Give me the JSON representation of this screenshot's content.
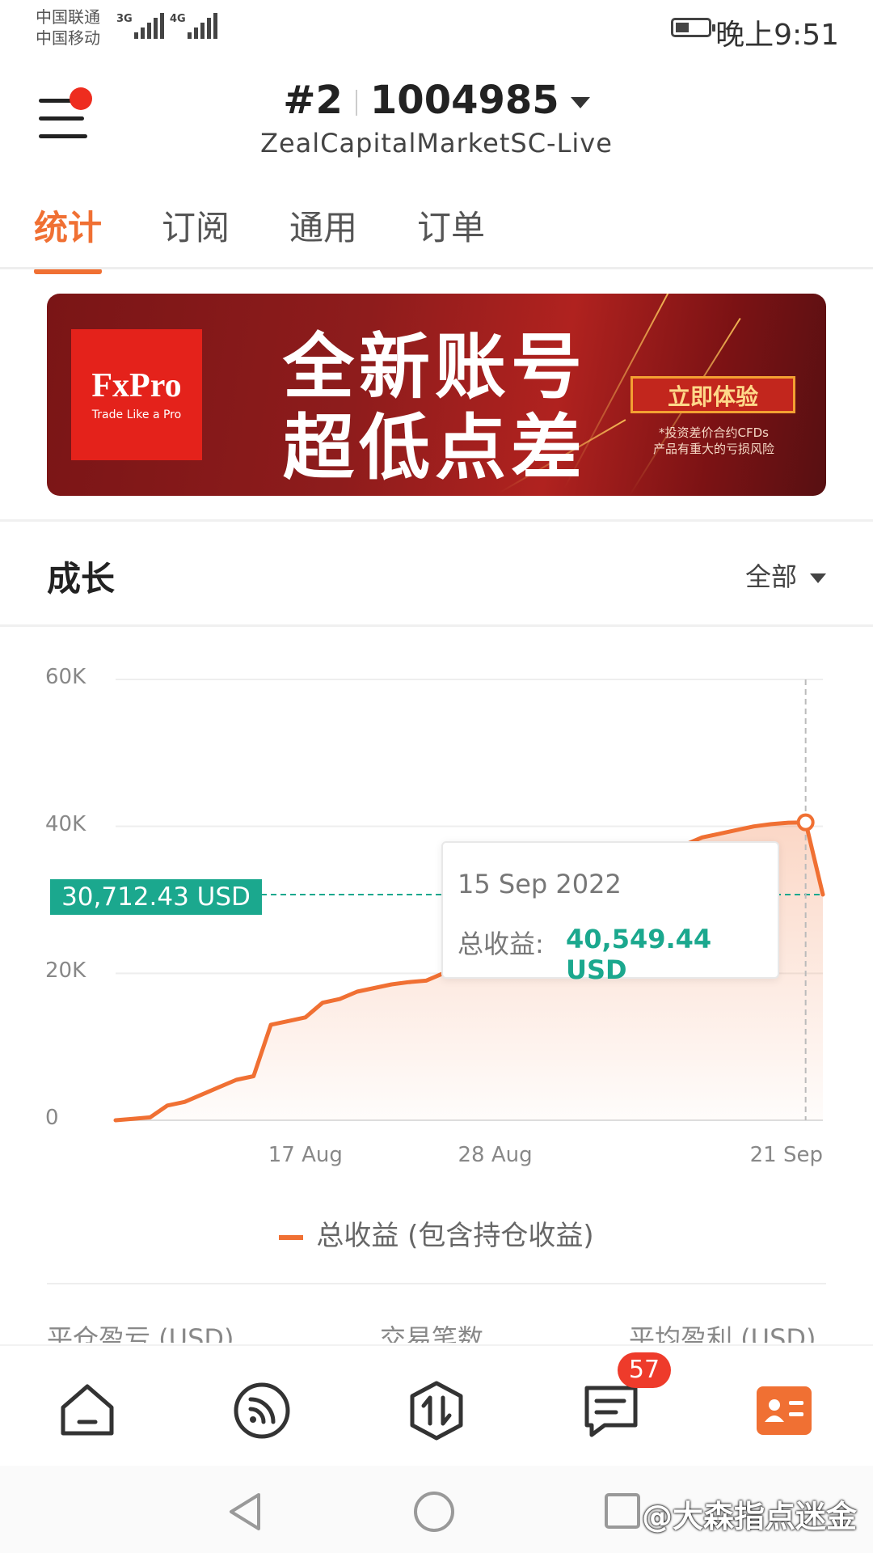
{
  "status_bar": {
    "carrier1": "中国联通",
    "carrier2": "中国移动",
    "net1": "3G",
    "net2": "4G",
    "time": "晚上9:51"
  },
  "header": {
    "account_index": "#2",
    "account_number": "1004985",
    "server": "ZealCapitalMarketSC-Live"
  },
  "tabs": [
    {
      "label": "统计",
      "active": true
    },
    {
      "label": "订阅",
      "active": false
    },
    {
      "label": "通用",
      "active": false
    },
    {
      "label": "订单",
      "active": false
    }
  ],
  "banner": {
    "brand": "FxPro",
    "tagline": "Trade Like a Pro",
    "headline1": "全新账号",
    "headline2": "超低点差",
    "cta": "立即体验",
    "disclaimer1": "*投资差价合约CFDs",
    "disclaimer2": "产品有重大的亏损风险"
  },
  "growth": {
    "title": "成长",
    "range": "全部"
  },
  "chart_data": {
    "type": "area",
    "ylim": [
      0,
      60000
    ],
    "y_ticks": [
      "0",
      "20K",
      "40K",
      "60K"
    ],
    "x_tick_labels": [
      "17 Aug",
      "28 Aug",
      "21 Sep"
    ],
    "x_tick_dates": [
      "2022-08-17",
      "2022-08-28",
      "2022-09-21"
    ],
    "series": [
      {
        "name": "总收益 (包含持仓收益)",
        "color": "#f07033",
        "x": [
          "2022-08-06",
          "2022-08-07",
          "2022-08-08",
          "2022-08-09",
          "2022-08-10",
          "2022-08-11",
          "2022-08-12",
          "2022-08-13",
          "2022-08-14",
          "2022-08-15",
          "2022-08-16",
          "2022-08-17",
          "2022-08-18",
          "2022-08-19",
          "2022-08-20",
          "2022-08-21",
          "2022-08-22",
          "2022-08-23",
          "2022-08-24",
          "2022-08-25",
          "2022-08-26",
          "2022-08-27",
          "2022-08-28",
          "2022-08-29",
          "2022-08-30",
          "2022-08-31",
          "2022-09-01",
          "2022-09-02",
          "2022-09-03",
          "2022-09-04",
          "2022-09-05",
          "2022-09-06",
          "2022-09-07",
          "2022-09-08",
          "2022-09-09",
          "2022-09-10",
          "2022-09-11",
          "2022-09-12",
          "2022-09-13",
          "2022-09-14",
          "2022-09-15",
          "2022-09-16"
        ],
        "values": [
          0,
          200,
          400,
          2000,
          2500,
          3500,
          4500,
          5500,
          6000,
          13000,
          13500,
          14000,
          16000,
          16500,
          17500,
          18000,
          18500,
          18800,
          19000,
          20000,
          21500,
          22500,
          24000,
          25500,
          26500,
          27500,
          29000,
          30000,
          31000,
          32000,
          33500,
          35000,
          36500,
          37500,
          38500,
          39000,
          39500,
          40000,
          40300,
          40500,
          40549.44,
          30712.43
        ]
      }
    ],
    "reference_line": {
      "value": 30712.43,
      "label": "30,712.43 USD",
      "color": "#1ba88e"
    },
    "highlight": {
      "date": "15 Sep 2022",
      "label": "总收益:",
      "value": "40,549.44 USD"
    }
  },
  "stats_headers": [
    "平仓盈亏 (USD)",
    "交易笔数",
    "平均盈利 (USD)"
  ],
  "bottom_nav": {
    "items": [
      "home-icon",
      "feed-icon",
      "trade-icon",
      "messages-icon",
      "profile-icon"
    ],
    "messages_badge": "57",
    "accent": "#f07033"
  },
  "watermark": "@大森指点迷金"
}
